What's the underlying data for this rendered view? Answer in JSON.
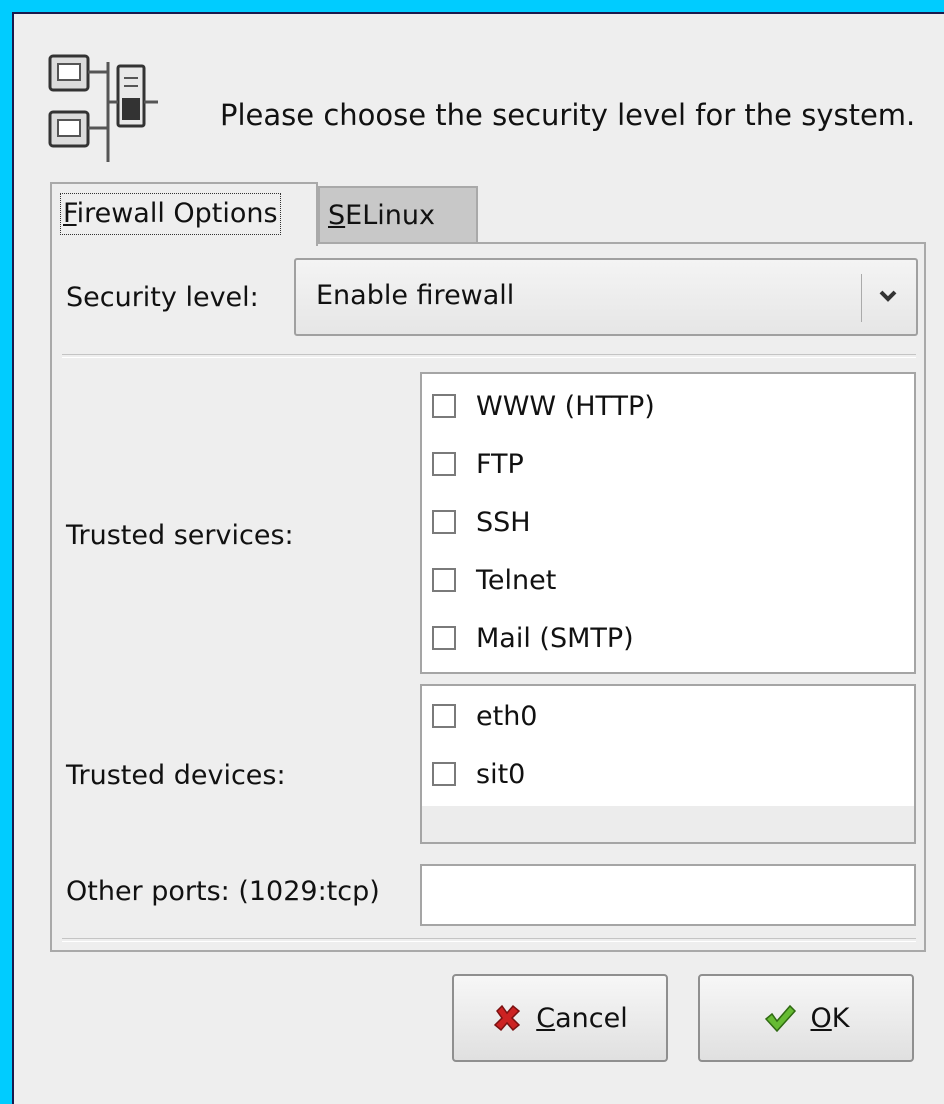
{
  "header": {
    "icon": "network-security-icon",
    "text": "Please choose the security level for the system."
  },
  "tabs": [
    {
      "mnemonic": "F",
      "rest": "irewall Options",
      "active": true
    },
    {
      "mnemonic": "S",
      "rest": "ELinux",
      "active": false
    }
  ],
  "security": {
    "label": "Security level:",
    "value": "Enable firewall",
    "arrow_icon": "chevron-down-icon"
  },
  "services": {
    "label": "Trusted services:",
    "items": [
      {
        "label": "WWW (HTTP)",
        "checked": false
      },
      {
        "label": "FTP",
        "checked": false
      },
      {
        "label": "SSH",
        "checked": false
      },
      {
        "label": "Telnet",
        "checked": false
      },
      {
        "label": "Mail (SMTP)",
        "checked": false
      }
    ]
  },
  "devices": {
    "label": "Trusted devices:",
    "items": [
      {
        "label": "eth0",
        "checked": false
      },
      {
        "label": "sit0",
        "checked": false
      }
    ]
  },
  "ports": {
    "label": "Other ports: (1029:tcp)",
    "value": ""
  },
  "buttons": {
    "cancel": {
      "mnemonic": "C",
      "rest": "ancel",
      "icon": "red-x-icon",
      "icon_color": "#cc2222"
    },
    "ok": {
      "mnemonic": "O",
      "rest": "K",
      "icon": "green-checkmark-icon",
      "icon_color": "#44aa22"
    }
  }
}
